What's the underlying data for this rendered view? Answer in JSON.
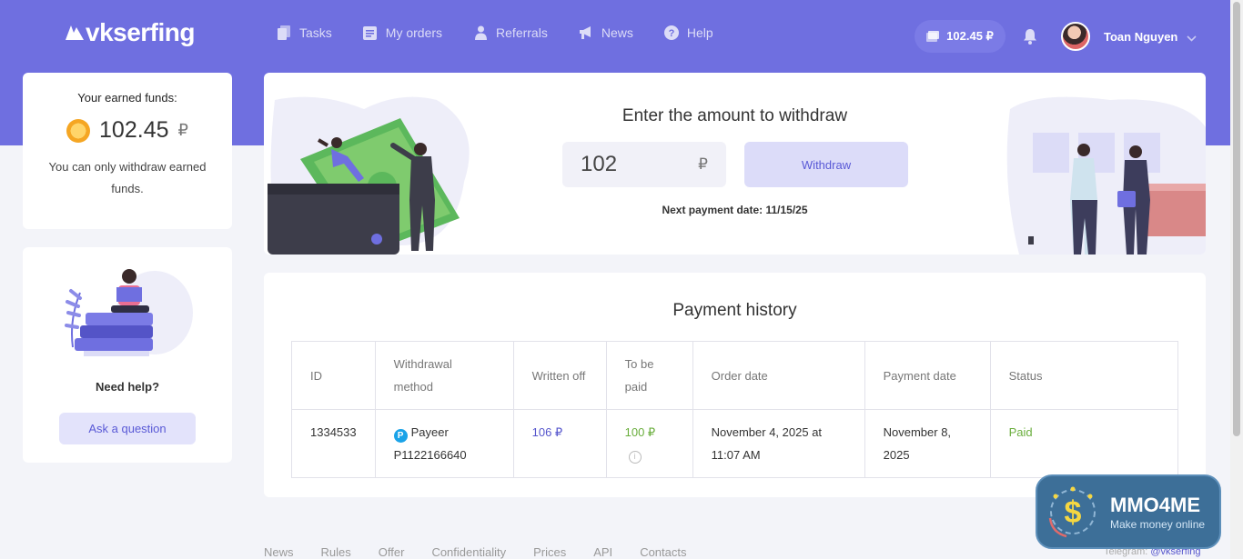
{
  "header": {
    "logo": "vkserfing",
    "nav": [
      {
        "label": "Tasks",
        "icon": "tasks-icon"
      },
      {
        "label": "My orders",
        "icon": "orders-icon"
      },
      {
        "label": "Referrals",
        "icon": "referrals-icon"
      },
      {
        "label": "News",
        "icon": "megaphone-icon"
      },
      {
        "label": "Help",
        "icon": "help-icon"
      }
    ],
    "balance": "102.45 ₽",
    "user_name": "Toan Nguyen"
  },
  "funds": {
    "label": "Your earned funds:",
    "amount": "102.45",
    "currency": "₽",
    "note": "You can only withdraw earned funds."
  },
  "help": {
    "title": "Need help?",
    "button": "Ask a question"
  },
  "withdraw": {
    "heading": "Enter the amount to withdraw",
    "amount_value": "102",
    "currency": "₽",
    "button": "Withdraw",
    "next_payment": "Next payment date: 11/15/25"
  },
  "history": {
    "heading": "Payment history",
    "columns": [
      "ID",
      "Withdrawal method",
      "Written off",
      "To be paid",
      "Order date",
      "Payment date",
      "Status"
    ],
    "rows": [
      {
        "id": "1334533",
        "method": "Payeer",
        "account": "P1122166640",
        "written_off": "106 ₽",
        "to_be_paid": "100 ₽",
        "order_date": "November 4, 2025 at 11:07 AM",
        "payment_date": "November 8, 2025",
        "status": "Paid"
      }
    ]
  },
  "footer": {
    "links": [
      "News",
      "Rules",
      "Offer",
      "Confidentiality",
      "Prices",
      "API",
      "Contacts"
    ],
    "telegram_label": "Telegram:",
    "telegram_handle": "@vkserfing"
  },
  "watermark": {
    "title": "MMO4ME",
    "subtitle": "Make money online"
  },
  "colors": {
    "brand": "#6f6fe0",
    "accent_light": "#dcdcf9",
    "paid_green": "#6aae3d",
    "link_blue": "#5555cc"
  }
}
